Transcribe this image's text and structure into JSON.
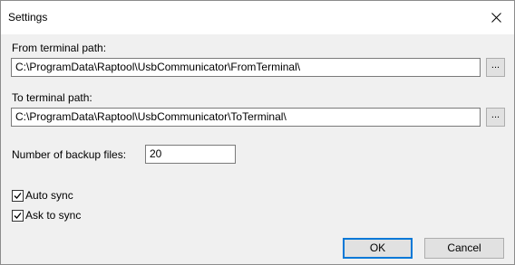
{
  "window": {
    "title": "Settings"
  },
  "from_terminal": {
    "label": "From terminal path:",
    "value": "C:\\ProgramData\\Raptool\\UsbCommunicator\\FromTerminal\\",
    "browse_label": "..."
  },
  "to_terminal": {
    "label": "To terminal path:",
    "value": "C:\\ProgramData\\Raptool\\UsbCommunicator\\ToTerminal\\",
    "browse_label": "..."
  },
  "backup": {
    "label": "Number of backup files:",
    "value": "20"
  },
  "auto_sync": {
    "label": "Auto sync",
    "checked": true
  },
  "ask_to_sync": {
    "label": "Ask to sync",
    "checked": true
  },
  "buttons": {
    "ok": "OK",
    "cancel": "Cancel"
  },
  "icons": {
    "close": "close-icon",
    "check": "checkmark-icon"
  },
  "colors": {
    "default_button_border": "#0078d7"
  }
}
